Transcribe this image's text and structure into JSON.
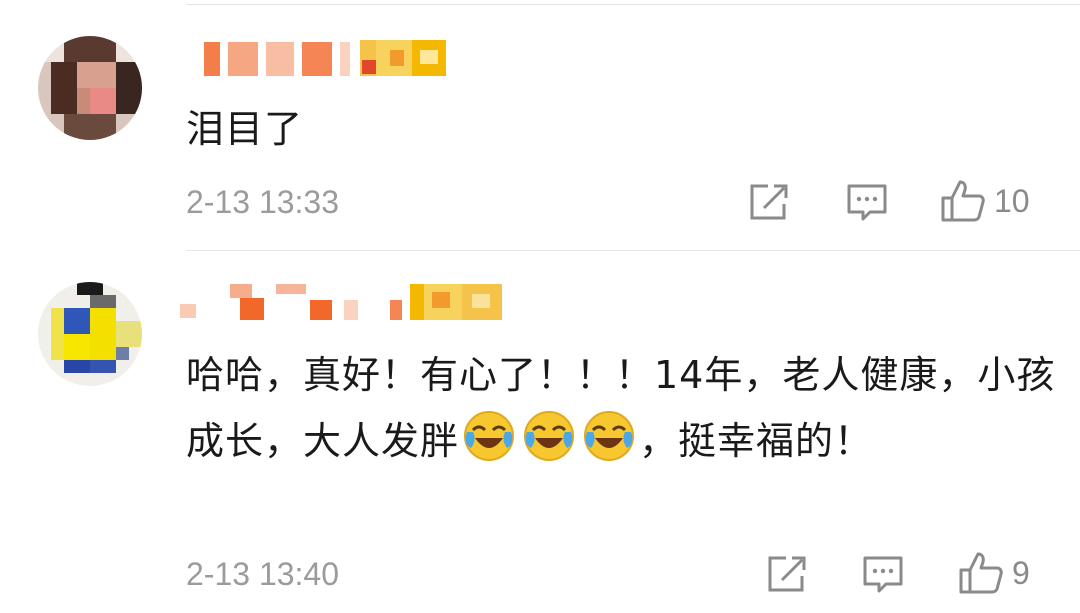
{
  "comments": [
    {
      "content": "泪目了",
      "time": "2-13 13:33",
      "likes": "10",
      "share_icon": "share-icon",
      "reply_icon": "comment-icon",
      "like_icon": "thumbs-up-icon"
    },
    {
      "content_parts": [
        "哈哈，真好！有心了！！！14年，老人健康，小孩成长，大人发胖",
        "，挺幸福的！"
      ],
      "emoji": [
        "laugh-cry-emoji",
        "laugh-cry-emoji",
        "laugh-cry-emoji"
      ],
      "time": "2-13 13:40",
      "likes": "9",
      "share_icon": "share-icon",
      "reply_icon": "comment-icon",
      "like_icon": "thumbs-up-icon"
    }
  ],
  "colors": {
    "text": "#1a1a1a",
    "meta": "#9b9b9b",
    "divider": "#e6e6e6",
    "username_orange": "#f2672a",
    "username_gold": "#f5b800"
  }
}
